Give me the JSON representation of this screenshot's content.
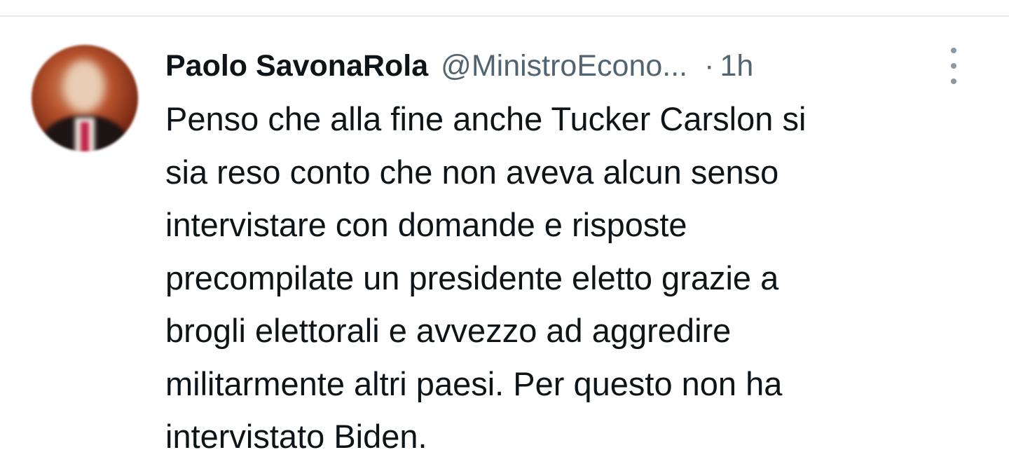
{
  "tweet": {
    "display_name": "Paolo SavonaRola",
    "handle": "@MinistroEcono...",
    "separator": "·",
    "time": "1h",
    "text": "Penso che alla fine anche Tucker Carslon si\nsia reso conto che non aveva alcun senso\nintervistare con domande e risposte\nprecompilate un presidente eletto grazie a\nbrogli elettorali e avvezzo ad aggredire\nmilitarmente altri paesi. Per questo non ha\nintervistato Biden.",
    "more_icon": "more-vertical-icon"
  },
  "colors": {
    "text_primary": "#0f1419",
    "text_secondary": "#536471",
    "icon": "#8b98a5",
    "divider": "#e8ecef",
    "background": "#ffffff"
  }
}
